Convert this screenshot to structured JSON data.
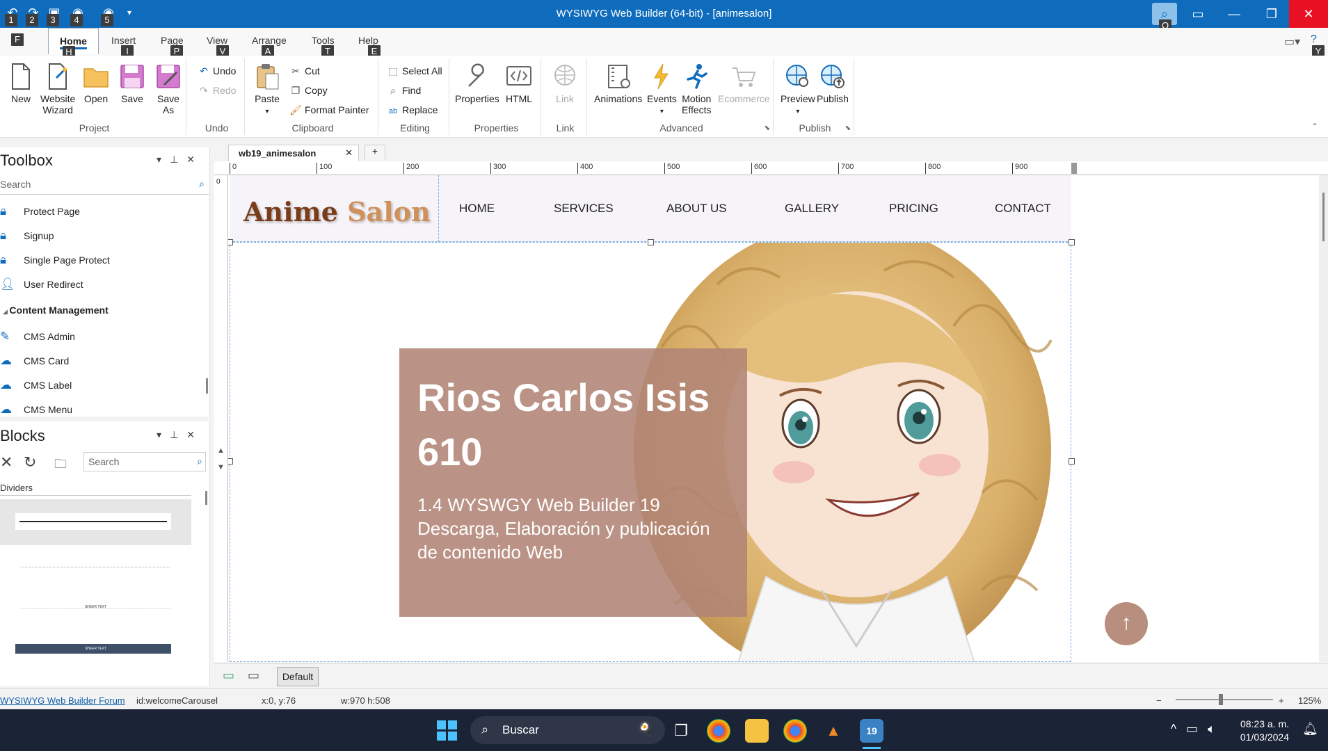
{
  "window": {
    "title": "WYSIWYG Web Builder (64-bit) - [animesalon]",
    "quick_access_keytips": [
      "1",
      "2",
      "3",
      "4",
      "5"
    ],
    "search_keytip": "Q",
    "help_keytip": "Y"
  },
  "ribbon_tabs": [
    {
      "label": "F",
      "keytip": ""
    },
    {
      "label": "Home",
      "keytip": "H"
    },
    {
      "label": "Insert",
      "keytip": "I"
    },
    {
      "label": "Page",
      "keytip": "P"
    },
    {
      "label": "View",
      "keytip": "V"
    },
    {
      "label": "Arrange",
      "keytip": "A"
    },
    {
      "label": "Tools",
      "keytip": "T"
    },
    {
      "label": "Help",
      "keytip": "E"
    }
  ],
  "ribbon": {
    "project": {
      "label": "Project",
      "new": "New",
      "wizard_1": "Website",
      "wizard_2": "Wizard",
      "open": "Open",
      "save": "Save",
      "save_as_1": "Save",
      "save_as_2": "As"
    },
    "undo": {
      "label": "Undo",
      "undo": "Undo",
      "redo": "Redo"
    },
    "clipboard": {
      "label": "Clipboard",
      "paste": "Paste",
      "cut": "Cut",
      "copy": "Copy",
      "format_painter": "Format Painter"
    },
    "editing": {
      "label": "Editing",
      "select_all": "Select All",
      "find": "Find",
      "replace": "Replace"
    },
    "properties": {
      "label": "Properties",
      "properties": "Properties",
      "html": "HTML"
    },
    "link": {
      "label": "Link",
      "link": "Link"
    },
    "advanced": {
      "label": "Advanced",
      "animations": "Animations",
      "events": "Events",
      "motion_1": "Motion",
      "motion_2": "Effects",
      "ecommerce": "Ecommerce"
    },
    "publish": {
      "label": "Publish",
      "preview": "Preview",
      "publish": "Publish"
    }
  },
  "toolbox": {
    "title": "Toolbox",
    "search_placeholder": "Search",
    "items": [
      {
        "label": "Protect Page",
        "icon": "lock-icon"
      },
      {
        "label": "Signup",
        "icon": "lock-star-icon"
      },
      {
        "label": "Single Page Protect",
        "icon": "lock-page-icon"
      },
      {
        "label": "User Redirect",
        "icon": "user-redirect-icon"
      }
    ],
    "category": "Content Management",
    "cms_items": [
      {
        "label": "CMS Admin",
        "icon": "cms-admin-icon"
      },
      {
        "label": "CMS Card",
        "icon": "cms-card-icon"
      },
      {
        "label": "CMS Label",
        "icon": "cms-label-icon"
      },
      {
        "label": "CMS Menu",
        "icon": "cms-menu-icon"
      }
    ]
  },
  "blocks": {
    "title": "Blocks",
    "search_placeholder": "Search",
    "section": "Dividers",
    "divider_caption": "SHEER TEXT"
  },
  "document": {
    "tab_label": "wb19_animesalon",
    "ruler_ticks": [
      "0",
      "100",
      "200",
      "300",
      "400",
      "500",
      "600",
      "700",
      "800",
      "900"
    ],
    "vruler_tick": "0",
    "default_button": "Default"
  },
  "site": {
    "logo_part1": "Anime",
    "logo_part2": "Salon",
    "nav": [
      "HOME",
      "SERVICES",
      "ABOUT US",
      "GALLERY",
      "PRICING",
      "CONTACT"
    ],
    "hero_title_line1": "Rios Carlos Isis",
    "hero_title_line2": "610",
    "hero_sub_line1": "1.4 WYSWGY Web Builder 19",
    "hero_sub_line2": "Descarga, Elaboración y publicación",
    "hero_sub_line3": "de contenido Web",
    "scroll_top_icon": "arrow-up-icon",
    "colors": {
      "logo_dark": "#7a3d1c",
      "logo_light": "#d0905a",
      "card": "#b08475",
      "accent": "#b88e7f"
    }
  },
  "status": {
    "forum_link": "WYSIWYG Web Builder Forum",
    "object_id": "id:welcomeCarousel",
    "position": "x:0, y:76",
    "size": "w:970 h:508",
    "zoom": "125%",
    "zoom_minus": "−",
    "zoom_plus": "+"
  },
  "taskbar": {
    "search_placeholder": "Buscar",
    "time": "08:23 a. m.",
    "date": "01/03/2024"
  }
}
